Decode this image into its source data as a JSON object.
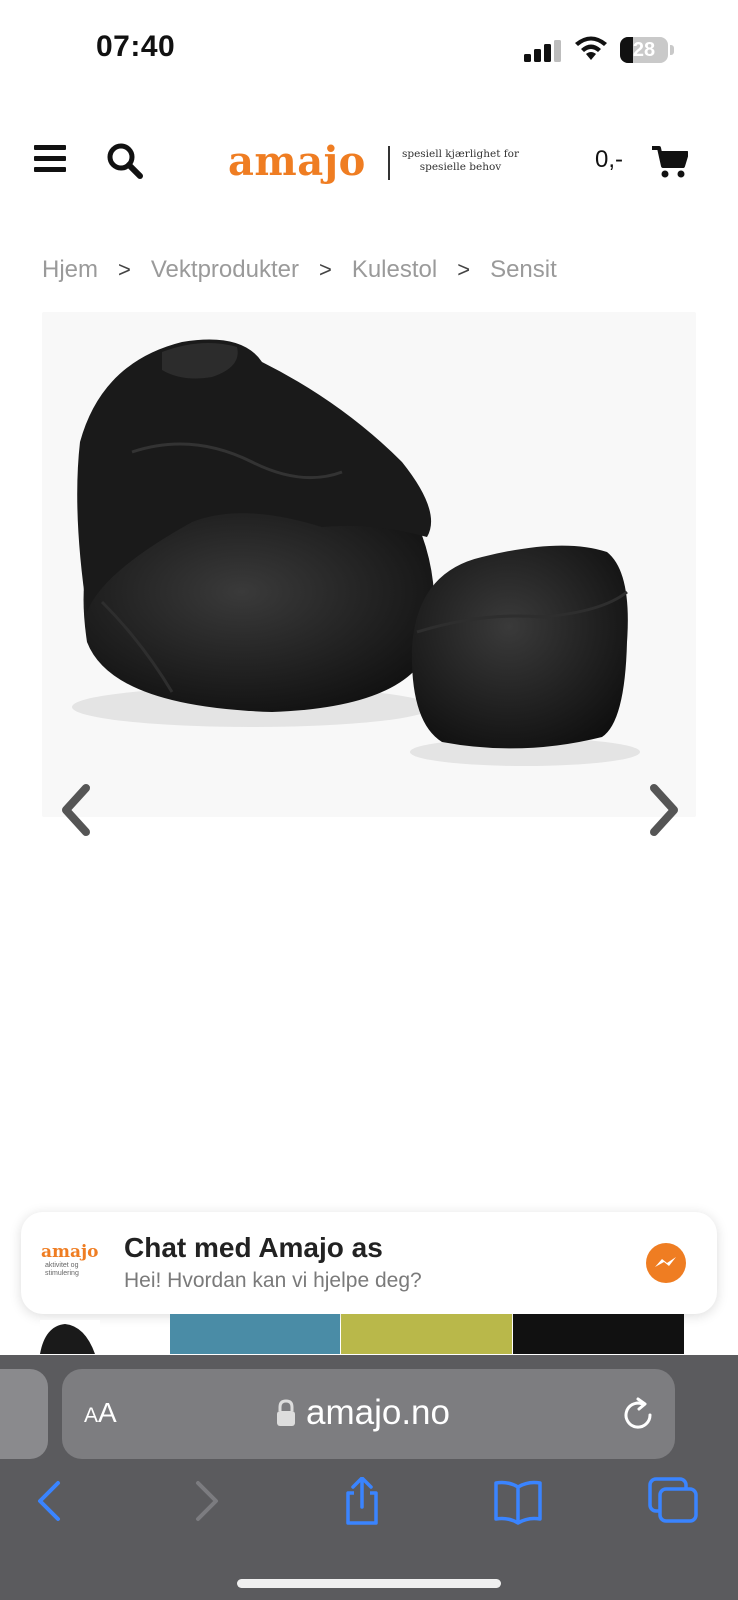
{
  "status_bar": {
    "time": "07:40",
    "battery_level": "28",
    "battery_fraction": 0.28
  },
  "header": {
    "logo_text": "amajo",
    "logo_tagline": "spesiell kjærlighet for spesielle behov",
    "cart_total": "0,-"
  },
  "breadcrumb": [
    "Hjem",
    "Vektprodukter",
    "Kulestol",
    "Sensit"
  ],
  "chat": {
    "logo_text": "amajo",
    "logo_tagline": "aktivitet og stimulering",
    "title": "Chat med Amajo as",
    "subtitle": "Hei! Hvordan kan vi hjelpe deg?"
  },
  "swatches": [
    {
      "color": "#4a8ca6"
    },
    {
      "color": "#b9b84a"
    },
    {
      "color": "#111111"
    }
  ],
  "browser": {
    "aa_label_small": "A",
    "aa_label_large": "A",
    "url": "amajo.no"
  },
  "colors": {
    "brand_orange": "#ef7d22",
    "ios_blue": "#3a84ff",
    "safari_bar": "#5b5b5e"
  }
}
